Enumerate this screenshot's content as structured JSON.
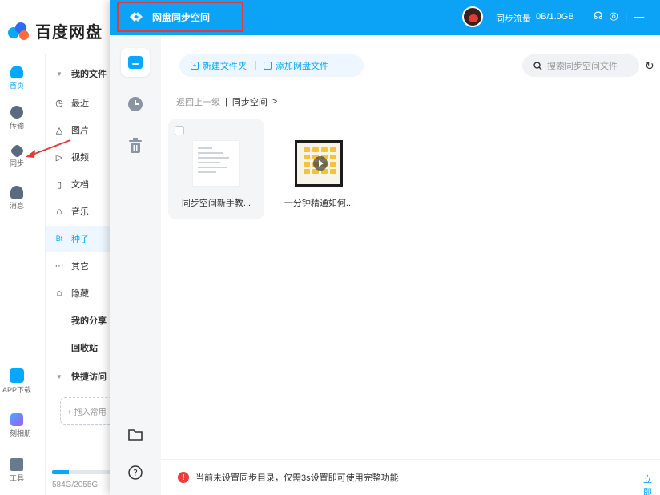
{
  "app": {
    "name": "百度网盘",
    "rail": [
      {
        "label": "首页"
      },
      {
        "label": "传输"
      },
      {
        "label": "同步"
      },
      {
        "label": "消息"
      },
      {
        "label": "APP下载"
      },
      {
        "label": "一刻相册"
      },
      {
        "label": "工具"
      }
    ],
    "panel": {
      "my_files": "我的文件",
      "items": [
        {
          "glyph": "◷",
          "label": "最近"
        },
        {
          "glyph": "△",
          "label": "图片"
        },
        {
          "glyph": "▷",
          "label": "视频"
        },
        {
          "glyph": "▯",
          "label": "文档"
        },
        {
          "glyph": "∩",
          "label": "音乐"
        },
        {
          "glyph": "Bt",
          "label": "种子"
        },
        {
          "glyph": "···",
          "label": "其它"
        },
        {
          "glyph": "⌂",
          "label": "隐藏"
        }
      ],
      "my_share": "我的分享",
      "recycle": "回收站",
      "quick_access": "快捷访问",
      "drop_hint": "+ 拖入常用",
      "storage_text": "584G/2055G",
      "storage_ratio": 0.284
    }
  },
  "sync": {
    "title": "网盘同步空间",
    "traffic_label": "同步流量",
    "traffic_value": "0B/1.0GB",
    "new_folder": "新建文件夹",
    "add_files": "添加网盘文件",
    "search_placeholder": "搜索同步空间文件",
    "breadcrumb": {
      "back": "返回上一级",
      "sep": "|",
      "current": "同步空间",
      "arrow": ">"
    },
    "files": [
      {
        "name": "同步空间新手教..."
      },
      {
        "name": "一分钟精通如何..."
      }
    ],
    "notice": "当前未设置同步目录，仅需3s设置即可使用完整功能",
    "notice_action": "立即"
  },
  "colors": {
    "accent": "#0ca2f6",
    "alert": "#ef3b3b",
    "highlight_border": "#e23a3a"
  }
}
